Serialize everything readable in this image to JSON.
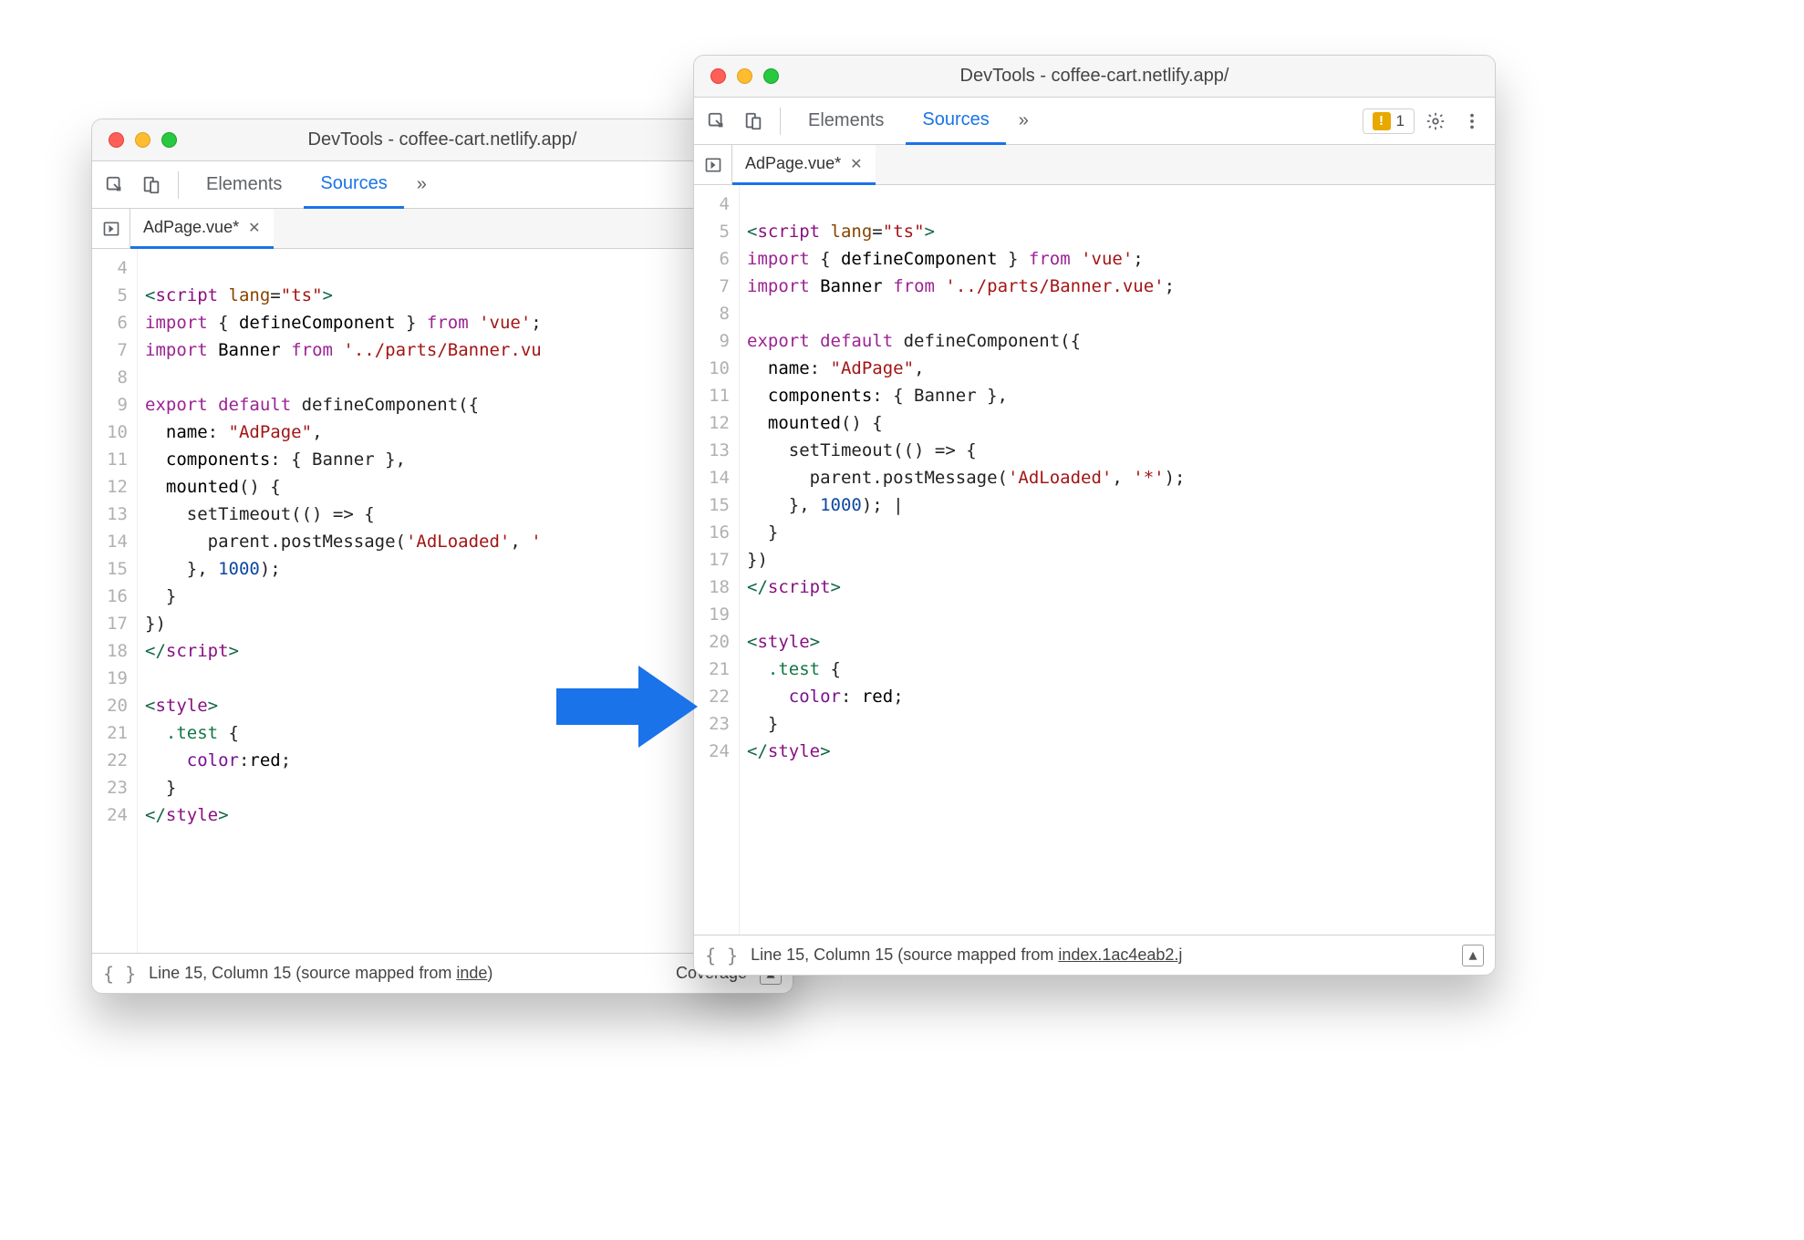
{
  "left": {
    "title": "DevTools - coffee-cart.netlify.app/",
    "tabs": {
      "elements": "Elements",
      "sources": "Sources",
      "overflow": "»"
    },
    "filetab": "AdPage.vue*",
    "lines_start": 4,
    "code": [
      {
        "n": 4,
        "t": []
      },
      {
        "n": 5,
        "t": [
          [
            "tag",
            "<"
          ],
          [
            "tagname",
            "script"
          ],
          [
            "",
            ""
          ],
          [
            "attr",
            " lang"
          ],
          [
            "",
            "="
          ],
          [
            "str",
            "\"ts\""
          ],
          [
            "tag",
            ">"
          ]
        ]
      },
      {
        "n": 6,
        "t": [
          [
            "kw",
            "import"
          ],
          [
            "",
            " { "
          ],
          [
            "fn",
            "defineComponent"
          ],
          [
            "",
            " } "
          ],
          [
            "kw",
            "from"
          ],
          [
            "",
            ""
          ],
          [
            "str",
            " 'vue'"
          ],
          [
            "",
            ";"
          ]
        ]
      },
      {
        "n": 7,
        "t": [
          [
            "kw",
            "import"
          ],
          [
            "",
            " "
          ],
          [
            "fn",
            "Banner"
          ],
          [
            "",
            " "
          ],
          [
            "kw",
            "from"
          ],
          [
            "",
            ""
          ],
          [
            "str",
            " '../parts/Banner.vu"
          ]
        ]
      },
      {
        "n": 8,
        "t": []
      },
      {
        "n": 9,
        "t": [
          [
            "kw",
            "export default"
          ],
          [
            "",
            " defineComponent({"
          ]
        ]
      },
      {
        "n": 10,
        "t": [
          [
            "",
            "  "
          ],
          [
            "fn",
            "name"
          ],
          [
            "",
            ": "
          ],
          [
            "str",
            "\"AdPage\""
          ],
          [
            "",
            ","
          ]
        ]
      },
      {
        "n": 11,
        "t": [
          [
            "",
            "  "
          ],
          [
            "fn",
            "components"
          ],
          [
            "",
            ": { Banner },"
          ]
        ]
      },
      {
        "n": 12,
        "t": [
          [
            "",
            "  "
          ],
          [
            "fn",
            "mounted"
          ],
          [
            "",
            "() {"
          ]
        ]
      },
      {
        "n": 13,
        "t": [
          [
            "",
            "    setTimeout(() => {"
          ]
        ]
      },
      {
        "n": 14,
        "t": [
          [
            "",
            "      parent.postMessage("
          ],
          [
            "str",
            "'AdLoaded'"
          ],
          [
            "",
            ", "
          ],
          [
            "str",
            "'"
          ]
        ]
      },
      {
        "n": 15,
        "t": [
          [
            "",
            "    }, "
          ],
          [
            "num",
            "1000"
          ],
          [
            "",
            ");"
          ]
        ]
      },
      {
        "n": 16,
        "t": [
          [
            "",
            "  }"
          ]
        ]
      },
      {
        "n": 17,
        "t": [
          [
            "",
            "})"
          ]
        ]
      },
      {
        "n": 18,
        "t": [
          [
            "tag",
            "</"
          ],
          [
            "tagname",
            "script"
          ],
          [
            "tag",
            ">"
          ]
        ]
      },
      {
        "n": 19,
        "t": []
      },
      {
        "n": 20,
        "t": [
          [
            "tag",
            "<"
          ],
          [
            "tagname",
            "style"
          ],
          [
            "tag",
            ">"
          ]
        ]
      },
      {
        "n": 21,
        "t": [
          [
            "",
            "  "
          ],
          [
            "css-sel",
            ".test"
          ],
          [
            "",
            " {"
          ]
        ]
      },
      {
        "n": 22,
        "t": [
          [
            "",
            "    "
          ],
          [
            "css-prop",
            "color"
          ],
          [
            "",
            ":"
          ],
          [
            "css-val",
            "red"
          ],
          [
            "",
            ";"
          ]
        ]
      },
      {
        "n": 23,
        "t": [
          [
            "",
            "  }"
          ]
        ]
      },
      {
        "n": 24,
        "t": [
          [
            "tag",
            "</"
          ],
          [
            "tagname",
            "style"
          ],
          [
            "tag",
            ">"
          ]
        ]
      }
    ],
    "status": {
      "pos": "Line 15, Column 15",
      "mapped": "(source mapped from ",
      "link": "inde",
      "coverage": "Coverage"
    }
  },
  "right": {
    "title": "DevTools - coffee-cart.netlify.app/",
    "tabs": {
      "elements": "Elements",
      "sources": "Sources",
      "overflow": "»"
    },
    "badge": "1",
    "filetab": "AdPage.vue*",
    "code": [
      {
        "n": 4,
        "t": []
      },
      {
        "n": 5,
        "t": [
          [
            "tag",
            "<"
          ],
          [
            "tagname",
            "script"
          ],
          [
            "",
            ""
          ],
          [
            "attr",
            " lang"
          ],
          [
            "",
            "="
          ],
          [
            "str",
            "\"ts\""
          ],
          [
            "tag",
            ">"
          ]
        ]
      },
      {
        "n": 6,
        "t": [
          [
            "kw",
            "import"
          ],
          [
            "",
            " { "
          ],
          [
            "fn",
            "defineComponent"
          ],
          [
            "",
            " } "
          ],
          [
            "kw",
            "from"
          ],
          [
            "",
            ""
          ],
          [
            "str",
            " 'vue'"
          ],
          [
            "",
            ";"
          ]
        ]
      },
      {
        "n": 7,
        "t": [
          [
            "kw",
            "import"
          ],
          [
            "",
            " "
          ],
          [
            "fn",
            "Banner"
          ],
          [
            "",
            " "
          ],
          [
            "kw",
            "from"
          ],
          [
            "",
            ""
          ],
          [
            "str",
            " '../parts/Banner.vue'"
          ],
          [
            "",
            ";"
          ]
        ]
      },
      {
        "n": 8,
        "t": []
      },
      {
        "n": 9,
        "t": [
          [
            "kw",
            "export default"
          ],
          [
            "",
            " defineComponent({"
          ]
        ]
      },
      {
        "n": 10,
        "t": [
          [
            "",
            "  "
          ],
          [
            "fn",
            "name"
          ],
          [
            "",
            ": "
          ],
          [
            "str",
            "\"AdPage\""
          ],
          [
            "",
            ","
          ]
        ]
      },
      {
        "n": 11,
        "t": [
          [
            "",
            "  "
          ],
          [
            "fn",
            "components"
          ],
          [
            "",
            ": { Banner },"
          ]
        ]
      },
      {
        "n": 12,
        "t": [
          [
            "",
            "  "
          ],
          [
            "fn",
            "mounted"
          ],
          [
            "",
            "() {"
          ]
        ]
      },
      {
        "n": 13,
        "t": [
          [
            "",
            "    setTimeout(() => {"
          ]
        ]
      },
      {
        "n": 14,
        "t": [
          [
            "",
            "      parent.postMessage("
          ],
          [
            "str",
            "'AdLoaded'"
          ],
          [
            "",
            ", "
          ],
          [
            "str",
            "'*'"
          ],
          [
            "",
            ");"
          ]
        ]
      },
      {
        "n": 15,
        "t": [
          [
            "",
            "    }, "
          ],
          [
            "num",
            "1000"
          ],
          [
            "",
            "); |"
          ]
        ]
      },
      {
        "n": 16,
        "t": [
          [
            "",
            "  }"
          ]
        ]
      },
      {
        "n": 17,
        "t": [
          [
            "",
            "})"
          ]
        ]
      },
      {
        "n": 18,
        "t": [
          [
            "tag",
            "</"
          ],
          [
            "tagname",
            "script"
          ],
          [
            "tag",
            ">"
          ]
        ]
      },
      {
        "n": 19,
        "t": []
      },
      {
        "n": 20,
        "t": [
          [
            "tag",
            "<"
          ],
          [
            "tagname",
            "style"
          ],
          [
            "tag",
            ">"
          ]
        ]
      },
      {
        "n": 21,
        "t": [
          [
            "",
            "  "
          ],
          [
            "css-sel",
            ".test"
          ],
          [
            "",
            " {"
          ]
        ]
      },
      {
        "n": 22,
        "t": [
          [
            "",
            "    "
          ],
          [
            "css-prop",
            "color"
          ],
          [
            "",
            ": "
          ],
          [
            "css-val",
            "red"
          ],
          [
            "",
            ";"
          ]
        ]
      },
      {
        "n": 23,
        "t": [
          [
            "",
            "  }"
          ]
        ]
      },
      {
        "n": 24,
        "t": [
          [
            "tag",
            "</"
          ],
          [
            "tagname",
            "style"
          ],
          [
            "tag",
            ">"
          ]
        ]
      }
    ],
    "status": {
      "pos": "Line 15, Column 15",
      "mapped": "(source mapped from ",
      "link": "index.1ac4eab2.j"
    }
  }
}
